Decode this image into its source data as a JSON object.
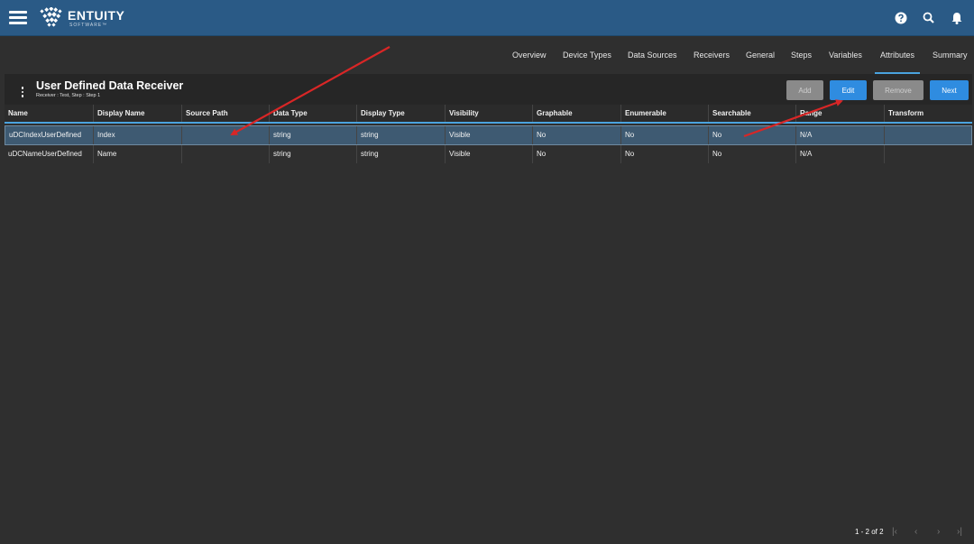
{
  "header": {
    "brand": "ENTUITY",
    "brand_sub": "SOFTWARE™"
  },
  "tabs": [
    {
      "label": "Overview"
    },
    {
      "label": "Device Types"
    },
    {
      "label": "Data Sources"
    },
    {
      "label": "Receivers"
    },
    {
      "label": "General"
    },
    {
      "label": "Steps"
    },
    {
      "label": "Variables"
    },
    {
      "label": "Attributes"
    },
    {
      "label": "Summary"
    }
  ],
  "active_tab": "Attributes",
  "page": {
    "title": "User Defined Data Receiver",
    "subtitle": "Receiver : Test, Step : Step 1"
  },
  "toolbar": {
    "add_label": "Add",
    "edit_label": "Edit",
    "remove_label": "Remove",
    "next_label": "Next"
  },
  "table": {
    "columns": [
      "Name",
      "Display Name",
      "Source Path",
      "Data Type",
      "Display Type",
      "Visibility",
      "Graphable",
      "Enumerable",
      "Searchable",
      "Range",
      "Transform"
    ],
    "rows": [
      [
        "uDCIndexUserDefined",
        "Index",
        "",
        "string",
        "string",
        "Visible",
        "No",
        "No",
        "No",
        "N/A",
        ""
      ],
      [
        "uDCNameUserDefined",
        "Name",
        "",
        "string",
        "string",
        "Visible",
        "No",
        "No",
        "No",
        "N/A",
        ""
      ]
    ],
    "selected_row": 0
  },
  "pagination": {
    "range_text": "1 - 2 of 2"
  },
  "colors": {
    "header_bg": "#2a5a86",
    "accent": "#2f8ce0",
    "selected_row": "#3e5a72",
    "annotation_arrow": "#d92626"
  }
}
